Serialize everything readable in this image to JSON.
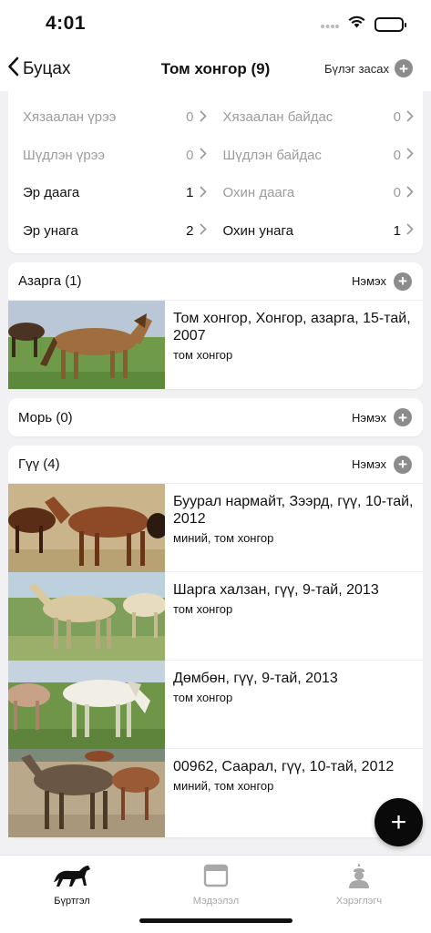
{
  "status_bar": {
    "time": "4:01"
  },
  "nav": {
    "back_label": "Буцах",
    "title": "Том хонгор (9)",
    "edit_group_label": "Бүлэг засах"
  },
  "stats": [
    {
      "label": "Хязаалан үрээ",
      "count": "0",
      "muted": true
    },
    {
      "label": "Хязаалан байдас",
      "count": "0",
      "muted": true
    },
    {
      "label": "Шүдлэн үрээ",
      "count": "0",
      "muted": true
    },
    {
      "label": "Шүдлэн байдас",
      "count": "0",
      "muted": true
    },
    {
      "label": "Эр даага",
      "count": "1",
      "muted": false
    },
    {
      "label": "Охин даага",
      "count": "0",
      "muted": true
    },
    {
      "label": "Эр унага",
      "count": "2",
      "muted": false
    },
    {
      "label": "Охин унага",
      "count": "1",
      "muted": false
    }
  ],
  "sections": {
    "azarga": {
      "title": "Азарга (1)",
      "add_label": "Нэмэх",
      "items": [
        {
          "name": "Том хонгор, Хонгор, азарга, 15-тай, 2007",
          "owner": "том хонгор"
        }
      ]
    },
    "mori": {
      "title": "Морь (0)",
      "add_label": "Нэмэх"
    },
    "guu": {
      "title": "Гүү (4)",
      "add_label": "Нэмэх",
      "items": [
        {
          "name": "Буурал нармайт, Зээрд, гүү, 10-тай, 2012",
          "owner": "миний, том хонгор"
        },
        {
          "name": "Шарга халзан, гүү, 9-тай, 2013",
          "owner": "том хонгор"
        },
        {
          "name": "Дөмбөн, гүү, 9-тай, 2013",
          "owner": "том хонгор"
        },
        {
          "name": "00962, Саарал, гүү, 10-тай, 2012",
          "owner": "миний, том хонгор"
        }
      ]
    }
  },
  "tabs": [
    {
      "label": "Бүртгэл",
      "icon": "horse-icon",
      "active": true
    },
    {
      "label": "Мэдээлэл",
      "icon": "browser-window-icon",
      "active": false
    },
    {
      "label": "Хэрэглэгч",
      "icon": "user-icon",
      "active": false
    }
  ],
  "colors": {
    "accent": "#0a0a0a",
    "muted": "#9c9c9c",
    "plus_circle": "#8c8c8c"
  }
}
